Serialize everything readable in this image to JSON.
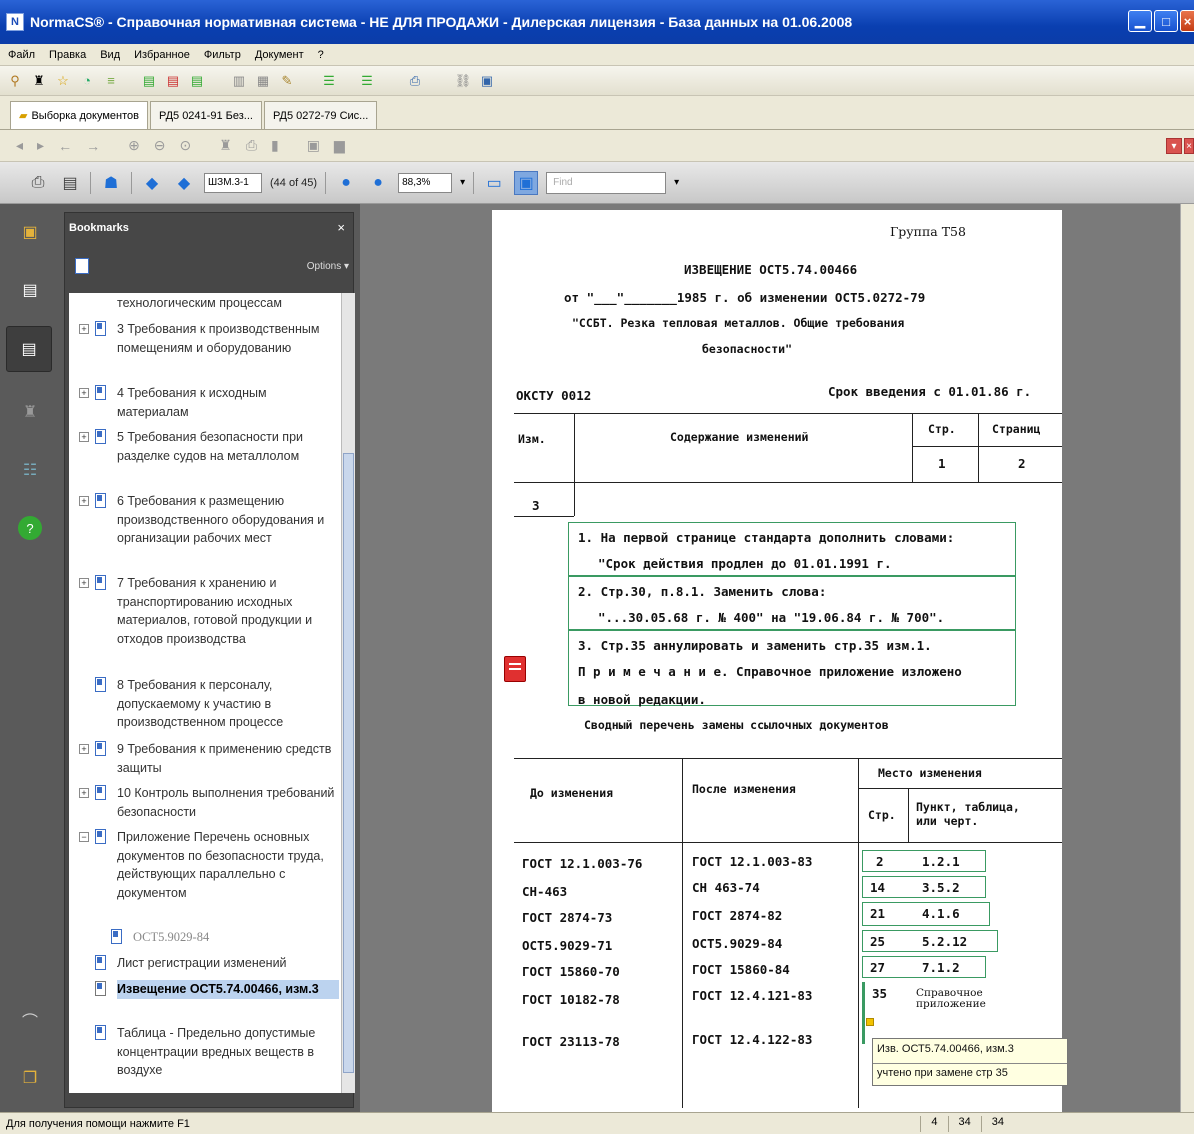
{
  "window": {
    "app_icon": "N",
    "title": "NormaCS® - Справочная нормативная система - НЕ ДЛЯ ПРОДАЖИ - Дилерская лицензия - База данных на 01.06.2008"
  },
  "menu": [
    "Файл",
    "Правка",
    "Вид",
    "Избранное",
    "Фильтр",
    "Документ",
    "?"
  ],
  "tabs": [
    {
      "label": "Выборка документов"
    },
    {
      "label": "РД5 0241-91 Без..."
    },
    {
      "label": "РД5 0272-79 Сис..."
    }
  ],
  "pdf_toolbar": {
    "page_input": "ШЗМ.3-1",
    "page_count": "(44 of 45)",
    "zoom": "88,3%",
    "find_placeholder": "Find"
  },
  "bookmarks": {
    "header": "Bookmarks",
    "close": "×",
    "options_label": "Options ▾",
    "items": [
      {
        "text": "технологическим процессам",
        "expander": "",
        "icon": false
      },
      {
        "text": "3 Требования к производственным помещениям и оборудованию",
        "expander": "+",
        "icon": true
      },
      {
        "text": "4 Требования к исходным материалам",
        "expander": "+",
        "icon": true
      },
      {
        "text": "5 Требования безопасности при разделке судов на металлолом",
        "expander": "+",
        "icon": true
      },
      {
        "text": "6 Требования к размещению производственного оборудования и организации рабочих мест",
        "expander": "+",
        "icon": true
      },
      {
        "text": "7 Требования к хранению и транспортированию исходных материалов, готовой продукции и отходов производства",
        "expander": "+",
        "icon": true
      },
      {
        "text": "8 Требования к персоналу, допускаемому к участию в производственном процессе",
        "expander": "",
        "icon": true
      },
      {
        "text": "9 Требования к применению средств защиты",
        "expander": "+",
        "icon": true
      },
      {
        "text": "10 Контроль выполнения требований безопасности",
        "expander": "+",
        "icon": true
      },
      {
        "text": "Приложение Перечень основных документов по безопасности труда, действующих параллельно с документом",
        "expander": "−",
        "icon": true
      },
      {
        "text": "ОСТ5.9029-84",
        "expander": "",
        "icon": true
      },
      {
        "text": "Лист регистрации изменений",
        "expander": "",
        "icon": true
      },
      {
        "text": "Извещение ОСТ5.74.00466, изм.3",
        "expander": "",
        "icon": true
      },
      {
        "text": "Таблица - Предельно допустимые концентрации вредных веществ в воздухе",
        "expander": "",
        "icon": true
      }
    ]
  },
  "document": {
    "group": "Группа Т58",
    "notice_title": "ИЗВЕЩЕНИЕ ОСТ5.74.00466",
    "notice_line": "от \"___\"_______1985 г. об изменении ОСТ5.0272-79",
    "notice_subject": "\"ССБТ. Резка тепловая металлов. Общие требования",
    "notice_subject2": "безопасности\"",
    "okstu": "ОКСТУ 0012",
    "intro_date": "Срок введения с 01.01.86 г.",
    "table_head": {
      "izm": "Изм.",
      "content": "Содержание изменений",
      "str": "Стр.",
      "pages": "Страниц",
      "str_val": "1",
      "pages_val": "2",
      "izm_val": "3"
    },
    "changes": [
      "1. На первой странице стандарта дополнить словами:",
      "\"Срок действия продлен до 01.01.1991 г.",
      "2. Стр.30, п.8.1. Заменить слова:",
      "\"...30.05.68 г. № 400\" на \"19.06.84 г. № 700\".",
      "3. Стр.35 аннулировать и заменить стр.35 изм.1.",
      "П р и м е ч а н и е. Справочное приложение изложено",
      "в новой редакции."
    ],
    "summary_title": "Сводный перечень замены ссылочных документов",
    "summary_head": {
      "before": "До изменения",
      "after": "После изменения",
      "place": "Место изменения",
      "str": "Стр.",
      "item": "Пункт, таблица,",
      "item2": "или черт."
    },
    "summary_rows": [
      {
        "before": "ГОСТ 12.1.003-76",
        "after": "ГОСТ 12.1.003-83",
        "str": "2",
        "item": "1.2.1"
      },
      {
        "before": "СН-463",
        "after": "СН 463-74",
        "str": "14",
        "item": "3.5.2"
      },
      {
        "before": "ГОСТ 2874-73",
        "after": "ГОСТ 2874-82",
        "str": "21",
        "item": "4.1.6"
      },
      {
        "before": "ОСТ5.9029-71",
        "after": "ОСТ5.9029-84",
        "str": "25",
        "item": "5.2.12"
      },
      {
        "before": "ГОСТ 15860-70",
        "after": "ГОСТ 15860-84",
        "str": "27",
        "item": "7.1.2"
      },
      {
        "before": "ГОСТ 10182-78",
        "after": "ГОСТ 12.4.121-83",
        "str": "35",
        "item": "Справочное приложение"
      },
      {
        "before": "ГОСТ 23113-78",
        "after": "ГОСТ 12.4.122-83",
        "str": "",
        "item": ""
      }
    ],
    "tooltip_line1": "Изв. ОСТ5.74.00466, изм.3",
    "tooltip_line2": "учтено при замене стр 35"
  },
  "status": {
    "help": "Для получения помощи нажмите F1",
    "c1": "4",
    "c2": "34",
    "c3": "34"
  }
}
